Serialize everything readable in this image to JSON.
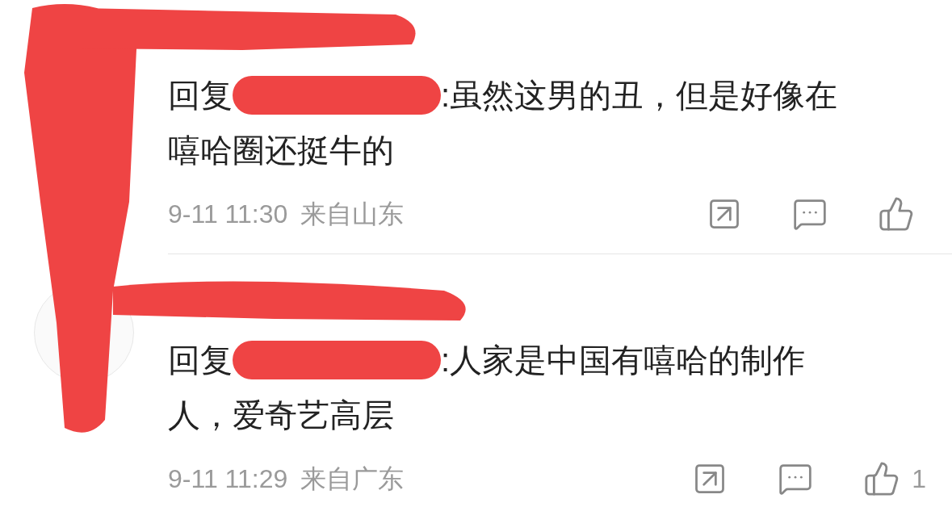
{
  "comments": [
    {
      "prefix": "回复",
      "lines": [
        ":虽然这男的丑，但是好像在",
        "嘻哈圈还挺牛的"
      ],
      "time": "9-11 11:30",
      "location": "来自山东"
    },
    {
      "prefix": "回复",
      "lines": [
        ":人家是中国有嘻哈的制作",
        "人，爱奇艺高层"
      ],
      "time": "9-11 11:29",
      "location": "来自广东",
      "like_count": "1"
    }
  ]
}
